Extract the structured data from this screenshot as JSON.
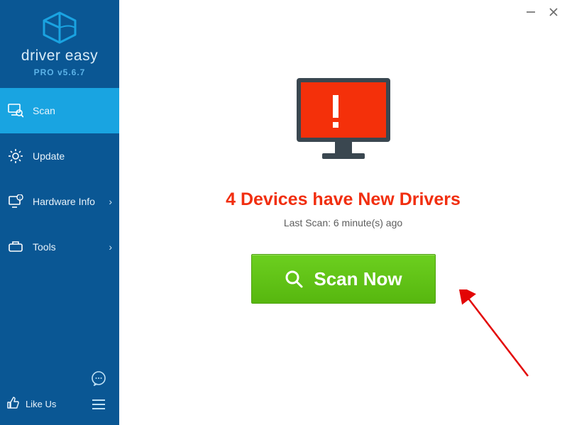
{
  "brand": {
    "name": "driver easy",
    "version": "PRO v5.6.7"
  },
  "sidebar": {
    "items": [
      {
        "label": "Scan"
      },
      {
        "label": "Update"
      },
      {
        "label": "Hardware Info"
      },
      {
        "label": "Tools"
      }
    ],
    "like_label": "Like Us"
  },
  "main": {
    "headline": "4 Devices have New Drivers",
    "last_scan": "Last Scan: 6 minute(s) ago",
    "scan_button": "Scan Now"
  }
}
